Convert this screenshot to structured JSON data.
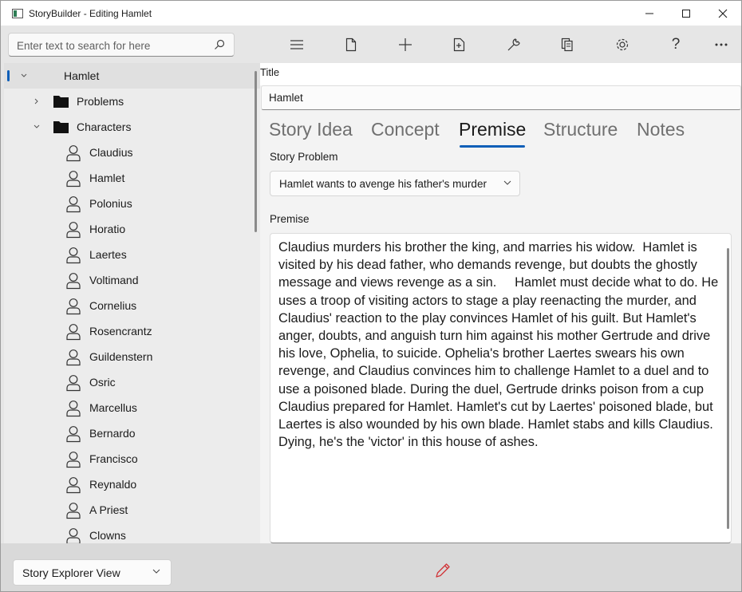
{
  "window": {
    "title": "StoryBuilder - Editing Hamlet",
    "minimize_label": "—",
    "maximize_label": "☐",
    "close_label": "✕"
  },
  "toolbar": {
    "search_placeholder": "Enter text to search for here",
    "icons": [
      "menu-icon",
      "new-file-icon",
      "add-icon",
      "add-element-icon",
      "tools-icon",
      "copy-icon",
      "settings-icon",
      "help-icon",
      "more-icon"
    ],
    "help_label": "?"
  },
  "sidebar": {
    "root": "Hamlet",
    "folders": [
      {
        "label": "Problems",
        "expanded": false
      },
      {
        "label": "Characters",
        "expanded": true
      }
    ],
    "characters": [
      "Claudius",
      "Hamlet",
      "Polonius",
      "Horatio",
      "Laertes",
      "Voltimand",
      "Cornelius",
      "Rosencrantz",
      "Guildenstern",
      "Osric",
      "Marcellus",
      "Bernardo",
      "Francisco",
      "Reynaldo",
      "A Priest",
      "Clowns"
    ]
  },
  "main": {
    "title_label": "Title",
    "title_value": "Hamlet",
    "tabs": [
      "Story Idea",
      "Concept",
      "Premise",
      "Structure",
      "Notes"
    ],
    "active_tab": "Premise",
    "story_problem_label": "Story Problem",
    "story_problem_value": "Hamlet wants to avenge his father's murder",
    "premise_label": "Premise",
    "premise_text": "Claudius murders his brother the king, and marries his widow.  Hamlet is visited by his dead father, who demands revenge, but doubts the ghostly message and views revenge as a sin.     Hamlet must decide what to do. He uses a troop of visiting actors to stage a play reenacting the murder, and Claudius' reaction to the play convinces Hamlet of his guilt. But Hamlet's anger, doubts, and anguish turn him against his mother Gertrude and drive his love, Ophelia, to suicide. Ophelia's brother Laertes swears his own revenge, and Claudius convinces him to challenge Hamlet to a duel and to use a poisoned blade. During the duel, Gertrude drinks poison from a cup Claudius prepared for Hamlet. Hamlet's cut by Laertes' poisoned blade, but Laertes is also wounded by his own blade. Hamlet stabs and kills Claudius. Dying, he's the 'victor' in this house of ashes."
  },
  "bottom": {
    "view_selector": "Story Explorer View",
    "accent_color": "#d13438"
  }
}
